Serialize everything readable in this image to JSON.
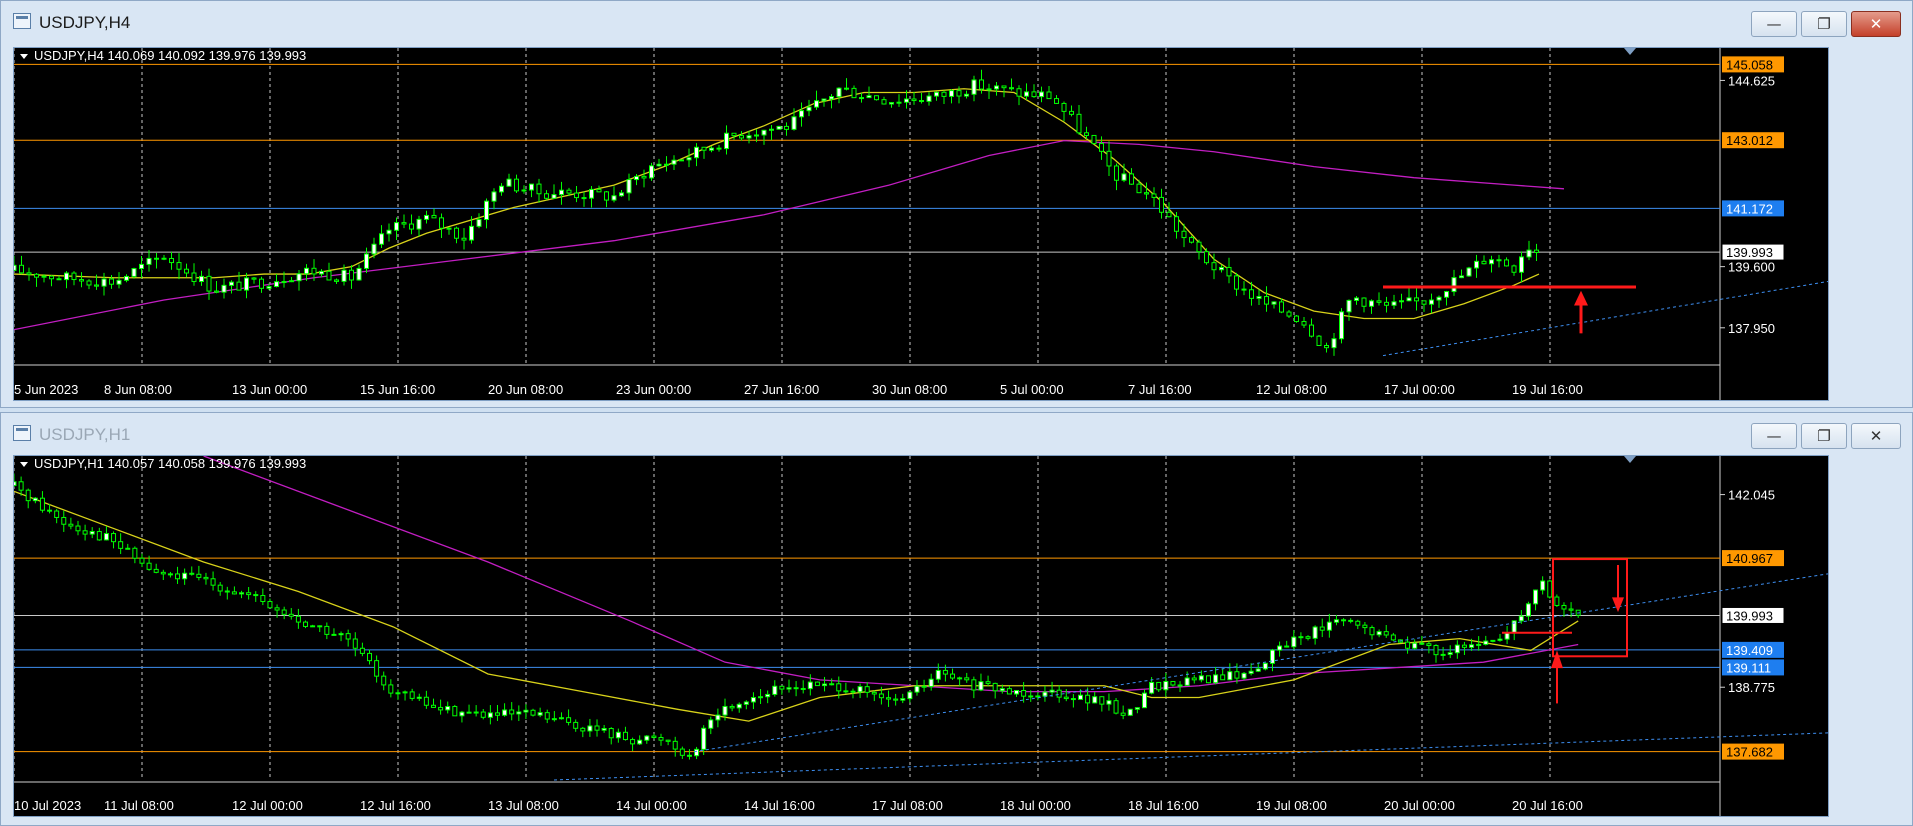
{
  "windows": [
    {
      "title": "USDJPY,H4",
      "info": "USDJPY,H4  140.069 140.092 139.976 139.993",
      "buttons": {
        "minimize": "—",
        "restore": "❐",
        "close": "✕"
      },
      "price_scale": {
        "min": 137.0,
        "max": 145.5
      },
      "price_axis_labels": [
        "144.625",
        "139.600",
        "137.950"
      ],
      "price_labels": [
        {
          "text": "145.058",
          "value": 145.058,
          "kind": "orange"
        },
        {
          "text": "143.012",
          "value": 143.012,
          "kind": "orange"
        },
        {
          "text": "141.172",
          "value": 141.172,
          "kind": "blue"
        },
        {
          "text": "139.993",
          "value": 139.993,
          "kind": "current"
        }
      ],
      "time_labels": [
        "5 Jun 2023",
        "8 Jun 08:00",
        "13 Jun 00:00",
        "15 Jun 16:00",
        "20 Jun 08:00",
        "23 Jun 00:00",
        "27 Jun 16:00",
        "30 Jun 08:00",
        "5 Jul 00:00",
        "7 Jul 16:00",
        "12 Jul 08:00",
        "17 Jul 00:00",
        "19 Jul 16:00"
      ],
      "close_path": [
        [
          0,
          139.5
        ],
        [
          20,
          139.3
        ],
        [
          40,
          139.2
        ],
        [
          60,
          139.9
        ],
        [
          80,
          139.0
        ],
        [
          100,
          139.2
        ],
        [
          118,
          139.5
        ],
        [
          135,
          139.3
        ],
        [
          150,
          140.6
        ],
        [
          165,
          140.9
        ],
        [
          180,
          140.4
        ],
        [
          195,
          141.9
        ],
        [
          210,
          141.6
        ],
        [
          220,
          141.6
        ],
        [
          240,
          141.5
        ],
        [
          255,
          142.3
        ],
        [
          270,
          142.6
        ],
        [
          290,
          143.2
        ],
        [
          310,
          143.4
        ],
        [
          330,
          144.4
        ],
        [
          350,
          144.1
        ],
        [
          370,
          144.2
        ],
        [
          385,
          144.5
        ],
        [
          400,
          144.3
        ],
        [
          415,
          144.2
        ],
        [
          430,
          143.0
        ],
        [
          440,
          142.1
        ],
        [
          455,
          141.5
        ],
        [
          470,
          140.2
        ],
        [
          485,
          139.3
        ],
        [
          500,
          138.6
        ],
        [
          515,
          138.2
        ],
        [
          525,
          137.4
        ],
        [
          535,
          138.8
        ],
        [
          550,
          138.5
        ],
        [
          565,
          138.7
        ],
        [
          580,
          139.4
        ],
        [
          590,
          139.9
        ],
        [
          600,
          139.6
        ],
        [
          605,
          140.2
        ],
        [
          610,
          139.993
        ]
      ],
      "fast_ma": [
        [
          0,
          139.4
        ],
        [
          40,
          139.3
        ],
        [
          80,
          139.3
        ],
        [
          100,
          139.4
        ],
        [
          118,
          139.4
        ],
        [
          135,
          139.6
        ],
        [
          150,
          140.1
        ],
        [
          165,
          140.5
        ],
        [
          180,
          140.8
        ],
        [
          200,
          141.2
        ],
        [
          220,
          141.5
        ],
        [
          240,
          141.8
        ],
        [
          260,
          142.3
        ],
        [
          280,
          142.9
        ],
        [
          300,
          143.4
        ],
        [
          320,
          144.0
        ],
        [
          340,
          144.3
        ],
        [
          360,
          144.3
        ],
        [
          380,
          144.4
        ],
        [
          400,
          144.3
        ],
        [
          420,
          143.5
        ],
        [
          440,
          142.5
        ],
        [
          460,
          141.3
        ],
        [
          480,
          139.8
        ],
        [
          500,
          138.9
        ],
        [
          520,
          138.4
        ],
        [
          540,
          138.2
        ],
        [
          560,
          138.2
        ],
        [
          580,
          138.6
        ],
        [
          600,
          139.1
        ],
        [
          610,
          139.4
        ]
      ],
      "slow_ma": [
        [
          0,
          137.9
        ],
        [
          60,
          138.7
        ],
        [
          120,
          139.3
        ],
        [
          180,
          139.8
        ],
        [
          240,
          140.3
        ],
        [
          300,
          141.0
        ],
        [
          350,
          141.8
        ],
        [
          390,
          142.6
        ],
        [
          420,
          143.0
        ],
        [
          450,
          142.9
        ],
        [
          480,
          142.7
        ],
        [
          520,
          142.3
        ],
        [
          560,
          142.0
        ],
        [
          600,
          141.8
        ],
        [
          620,
          141.7
        ]
      ]
    },
    {
      "title": "USDJPY,H1",
      "info": "USDJPY,H1  140.057 140.058 139.976 139.993",
      "buttons": {
        "minimize": "—",
        "restore": "❐",
        "close": "✕"
      },
      "price_scale": {
        "min": 137.2,
        "max": 142.7
      },
      "price_axis_labels": [
        "142.045",
        "138.775"
      ],
      "price_labels": [
        {
          "text": "140.967",
          "value": 140.967,
          "kind": "orange"
        },
        {
          "text": "139.993",
          "value": 139.993,
          "kind": "current"
        },
        {
          "text": "139.409",
          "value": 139.409,
          "kind": "blue"
        },
        {
          "text": "139.111",
          "value": 139.111,
          "kind": "blue"
        },
        {
          "text": "137.682",
          "value": 137.682,
          "kind": "orange"
        }
      ],
      "time_labels": [
        "10 Jul 2023",
        "11 Jul 08:00",
        "12 Jul 00:00",
        "12 Jul 16:00",
        "13 Jul 08:00",
        "14 Jul 00:00",
        "14 Jul 16:00",
        "17 Jul 08:00",
        "18 Jul 00:00",
        "18 Jul 16:00",
        "19 Jul 08:00",
        "20 Jul 00:00",
        "20 Jul 16:00"
      ],
      "close_path": [
        [
          0,
          142.2
        ],
        [
          20,
          141.6
        ],
        [
          40,
          141.3
        ],
        [
          60,
          140.7
        ],
        [
          80,
          140.6
        ],
        [
          100,
          140.3
        ],
        [
          120,
          139.9
        ],
        [
          140,
          139.6
        ],
        [
          160,
          138.7
        ],
        [
          180,
          138.4
        ],
        [
          200,
          138.3
        ],
        [
          220,
          138.3
        ],
        [
          240,
          138.1
        ],
        [
          260,
          137.9
        ],
        [
          275,
          137.9
        ],
        [
          285,
          137.6
        ],
        [
          295,
          138.3
        ],
        [
          310,
          138.6
        ],
        [
          330,
          138.8
        ],
        [
          350,
          138.8
        ],
        [
          370,
          138.5
        ],
        [
          380,
          138.7
        ],
        [
          390,
          139.0
        ],
        [
          405,
          138.8
        ],
        [
          420,
          138.7
        ],
        [
          440,
          138.7
        ],
        [
          460,
          138.5
        ],
        [
          470,
          138.3
        ],
        [
          480,
          138.8
        ],
        [
          500,
          138.9
        ],
        [
          520,
          139.0
        ],
        [
          540,
          139.6
        ],
        [
          560,
          139.9
        ],
        [
          580,
          139.6
        ],
        [
          600,
          139.4
        ],
        [
          610,
          139.4
        ],
        [
          620,
          139.5
        ],
        [
          630,
          139.7
        ],
        [
          640,
          140.3
        ],
        [
          645,
          140.6
        ],
        [
          650,
          140.2
        ],
        [
          660,
          139.993
        ]
      ],
      "fast_ma": [
        [
          0,
          142.1
        ],
        [
          40,
          141.5
        ],
        [
          80,
          140.9
        ],
        [
          120,
          140.4
        ],
        [
          160,
          139.8
        ],
        [
          200,
          139.0
        ],
        [
          240,
          138.7
        ],
        [
          280,
          138.4
        ],
        [
          310,
          138.2
        ],
        [
          340,
          138.6
        ],
        [
          380,
          138.8
        ],
        [
          420,
          138.8
        ],
        [
          460,
          138.8
        ],
        [
          480,
          138.6
        ],
        [
          500,
          138.6
        ],
        [
          540,
          138.9
        ],
        [
          580,
          139.5
        ],
        [
          610,
          139.6
        ],
        [
          640,
          139.4
        ],
        [
          660,
          139.9
        ]
      ],
      "slow_ma": [
        [
          80,
          142.7
        ],
        [
          140,
          141.8
        ],
        [
          200,
          140.9
        ],
        [
          260,
          139.9
        ],
        [
          300,
          139.2
        ],
        [
          340,
          138.9
        ],
        [
          380,
          138.8
        ],
        [
          420,
          138.7
        ],
        [
          460,
          138.7
        ],
        [
          500,
          138.8
        ],
        [
          540,
          139.0
        ],
        [
          580,
          139.1
        ],
        [
          620,
          139.2
        ],
        [
          660,
          139.5
        ]
      ]
    }
  ]
}
